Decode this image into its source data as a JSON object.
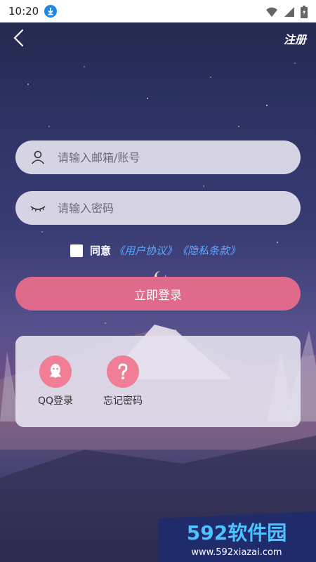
{
  "status_bar": {
    "time": "10:20"
  },
  "header": {
    "register_label": "注册"
  },
  "login_form": {
    "account_placeholder": "请输入邮箱/账号",
    "password_placeholder": "请输入密码",
    "agree_text": "同意",
    "user_agreement_link": "《用户协议》",
    "privacy_link": "《隐私条款》",
    "login_button": "立即登录"
  },
  "options_panel": {
    "qq_login_label": "QQ登录",
    "forgot_password_label": "忘记密码"
  },
  "watermark": {
    "brand": "592软件园",
    "url": "www.592xiazai.com"
  },
  "colors": {
    "accent": "#e06a8b",
    "link": "#5fa8ff",
    "option_circle": "#ef7e96"
  },
  "icons": [
    "download-icon",
    "wifi-icon",
    "signal-icon",
    "battery-icon",
    "back-arrow-icon",
    "user-icon",
    "eye-closed-icon",
    "qq-icon",
    "question-icon"
  ]
}
